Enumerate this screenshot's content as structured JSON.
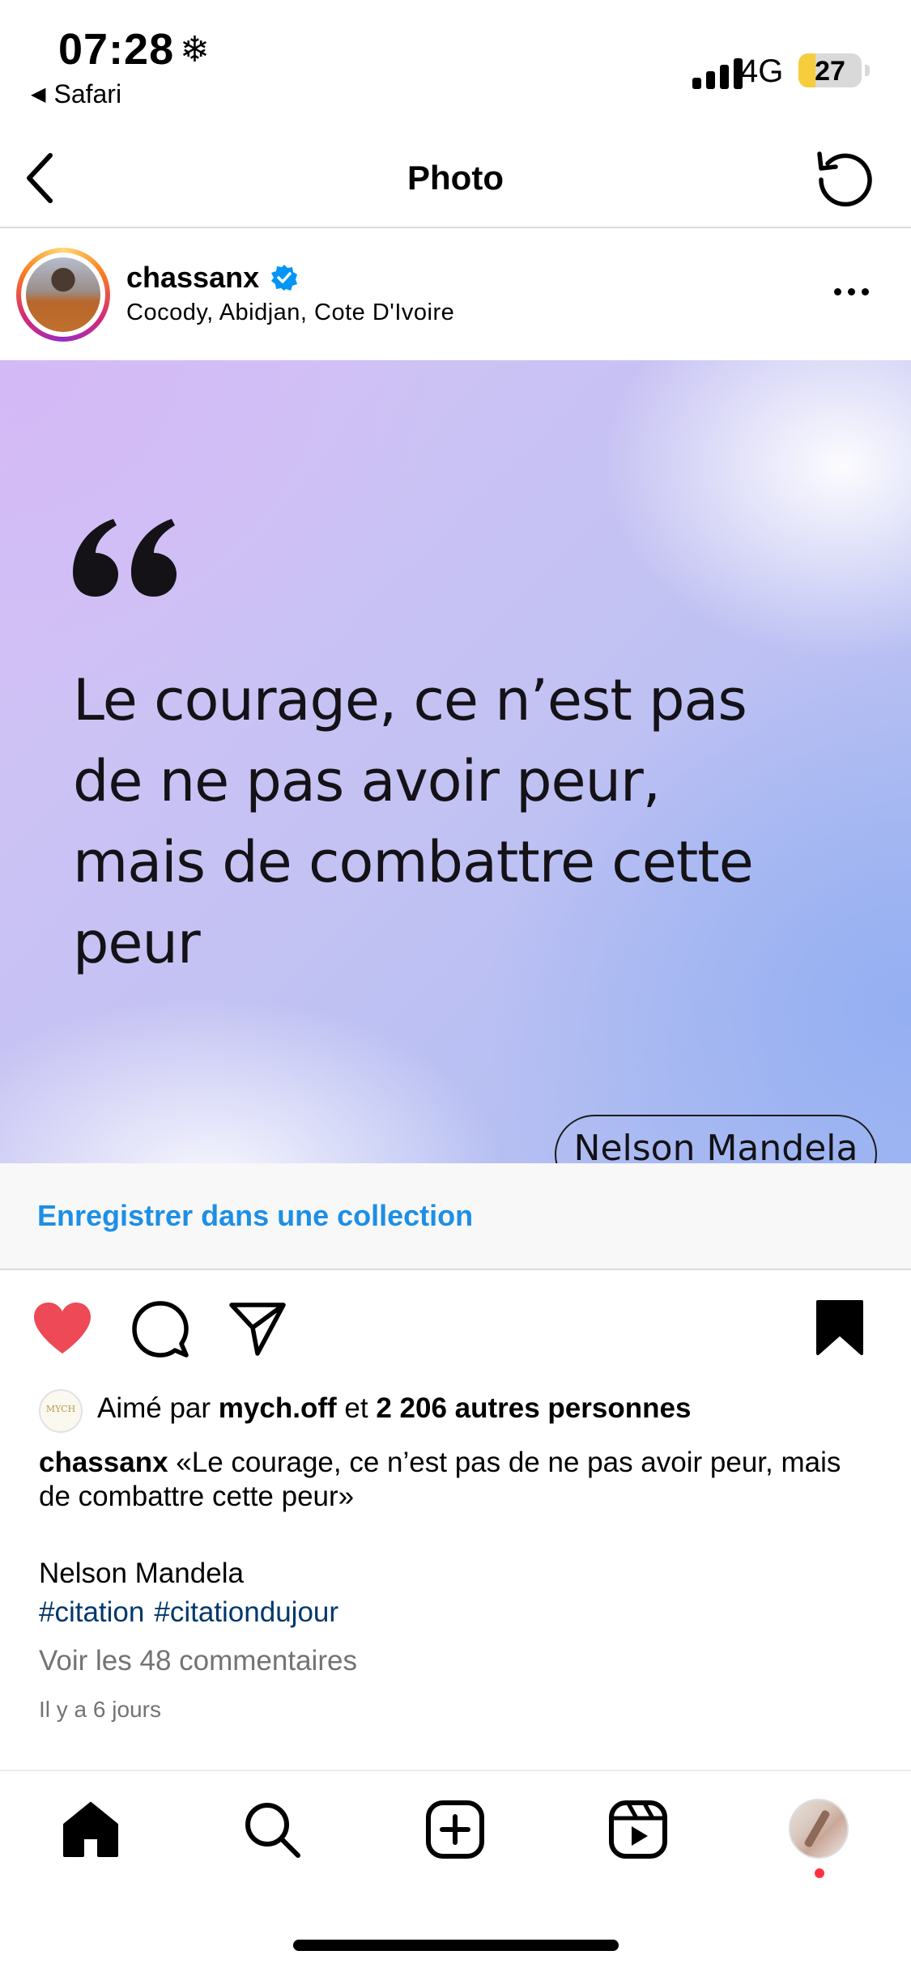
{
  "status_bar": {
    "time": "07:28",
    "time_icon": "snowflake-icon",
    "back_app": "Safari",
    "network": "4G",
    "battery_level": "27",
    "battery_fraction": 0.27
  },
  "header": {
    "title": "Photo",
    "back_icon": "chevron-left-icon",
    "refresh_icon": "refresh-icon"
  },
  "post": {
    "username": "chassanx",
    "verified": true,
    "location": "Cocody, Abidjan, Cote D'Ivoire",
    "quote_text": "Le courage, ce n’est pas de ne pas avoir peur, mais de combattre cette peur",
    "quote_author": "Nelson Mandela",
    "collection_link": "Enregistrer dans une collection",
    "likes": {
      "prefix": "Aimé par",
      "liked_by": "mych.off",
      "conjunction": "et",
      "others": "2 206 autres personnes",
      "liker_avatar_text": "MYCH"
    },
    "caption": {
      "username": "chassanx",
      "text": "«Le courage, ce n’est pas de ne pas avoir peur, mais de combattre cette peur»",
      "author": "Nelson Mandela",
      "hashtags": [
        "#citation",
        "#citationdujour"
      ]
    },
    "view_comments": "Voir les 48 commentaires",
    "timestamp": "Il y a 6 jours",
    "liked": true,
    "saved": true
  },
  "tab_bar": {
    "items": [
      "home-icon",
      "search-icon",
      "new-post-icon",
      "reels-icon",
      "profile-avatar"
    ]
  },
  "colors": {
    "accent_link": "#1d8fe6",
    "like_red": "#ed4956",
    "hashtag": "#00376b",
    "verified_blue": "#0095f6",
    "battery_yellow": "#f6cd3c"
  }
}
